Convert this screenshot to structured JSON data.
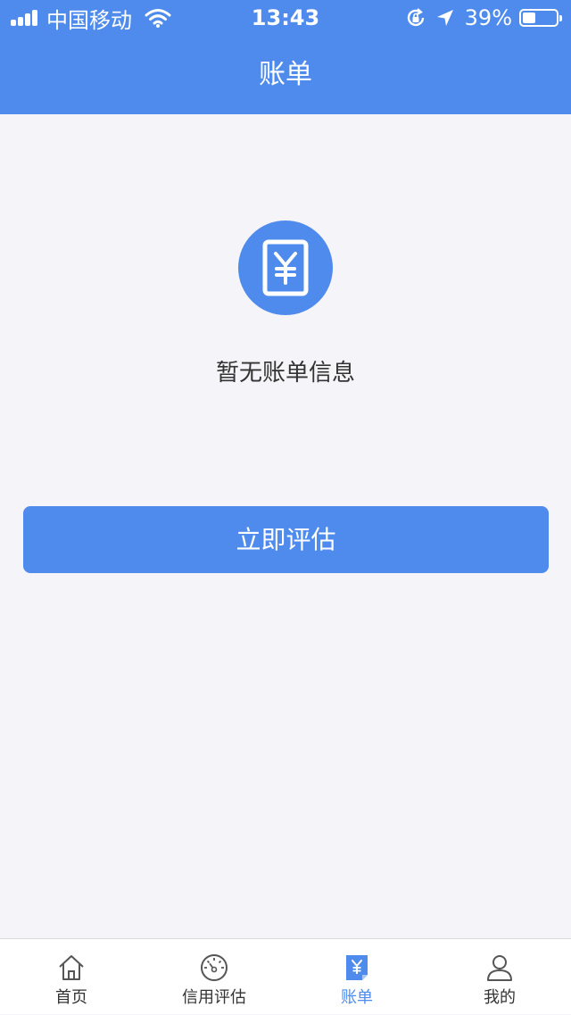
{
  "status_bar": {
    "carrier": "中国移动",
    "time": "13:43",
    "battery": "39%",
    "battery_level": 0.39
  },
  "header": {
    "title": "账单"
  },
  "empty_state": {
    "icon": "bill-yen-icon",
    "message": "暂无账单信息"
  },
  "action_button": {
    "label": "立即评估"
  },
  "tabbar": {
    "items": [
      {
        "label": "首页",
        "icon": "home-icon"
      },
      {
        "label": "信用评估",
        "icon": "gauge-icon"
      },
      {
        "label": "账单",
        "icon": "bill-icon",
        "active": true
      },
      {
        "label": "我的",
        "icon": "user-icon"
      }
    ]
  },
  "colors": {
    "primary": "#4f8bec",
    "background": "#f5f4f8",
    "text": "#333333"
  }
}
